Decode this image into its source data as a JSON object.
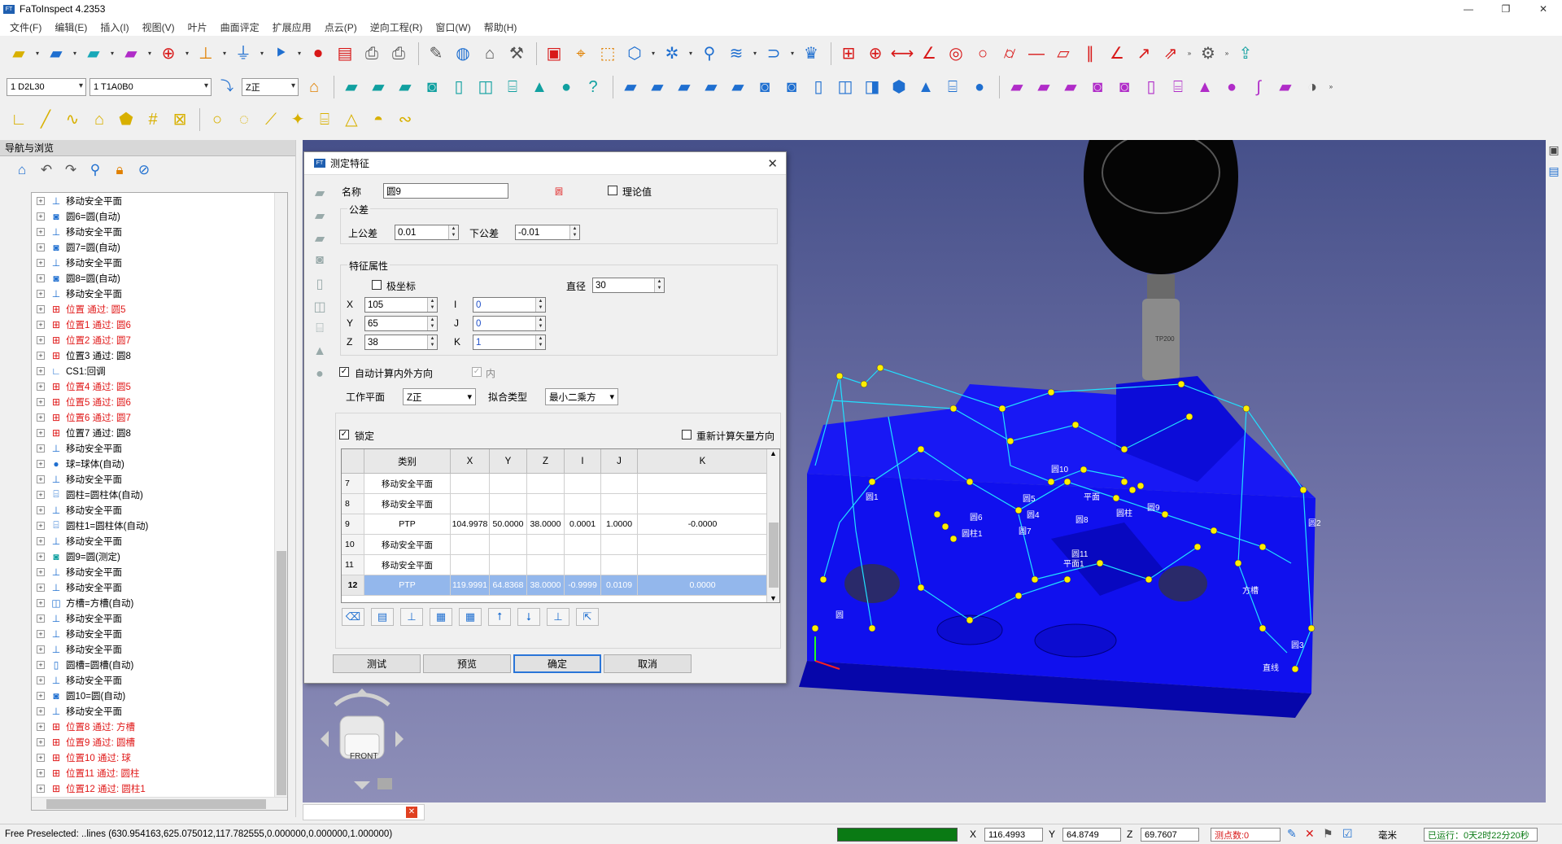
{
  "app": {
    "title": "FaToInspect 4.2353"
  },
  "menu": [
    "文件(F)",
    "编辑(E)",
    "插入(I)",
    "视图(V)",
    "叶片",
    "曲面评定",
    "扩展应用",
    "点云(P)",
    "逆向工程(R)",
    "窗口(W)",
    "帮助(H)"
  ],
  "toolbar2": {
    "probe": "1 D2L30",
    "tip": "1 T1A0B0",
    "workplane": "Z正"
  },
  "nav": {
    "title": "导航与浏览",
    "items": [
      {
        "label": "移动安全平面",
        "icon": "move-plane-icon",
        "red": false
      },
      {
        "label": "圆6=圆(自动)",
        "icon": "circle-feature-icon",
        "red": false
      },
      {
        "label": "移动安全平面",
        "icon": "move-plane-icon",
        "red": false
      },
      {
        "label": "圆7=圆(自动)",
        "icon": "circle-feature-icon",
        "red": false
      },
      {
        "label": "移动安全平面",
        "icon": "move-plane-icon",
        "red": false
      },
      {
        "label": "圆8=圆(自动)",
        "icon": "circle-feature-icon",
        "red": false
      },
      {
        "label": "移动安全平面",
        "icon": "move-plane-icon",
        "red": false
      },
      {
        "label": "位置 通过: 圆5",
        "icon": "position-icon",
        "red": true
      },
      {
        "label": "位置1 通过: 圆6",
        "icon": "position-icon",
        "red": true
      },
      {
        "label": "位置2 通过: 圆7",
        "icon": "position-icon",
        "red": true
      },
      {
        "label": "位置3 通过: 圆8",
        "icon": "position-icon",
        "red": false
      },
      {
        "label": "CS1:回调",
        "icon": "coordinate-system-icon",
        "red": false
      },
      {
        "label": "位置4 通过: 圆5",
        "icon": "position-icon",
        "red": true
      },
      {
        "label": "位置5 通过: 圆6",
        "icon": "position-icon",
        "red": true
      },
      {
        "label": "位置6 通过: 圆7",
        "icon": "position-icon",
        "red": true
      },
      {
        "label": "位置7 通过: 圆8",
        "icon": "position-icon",
        "red": false
      },
      {
        "label": "移动安全平面",
        "icon": "move-plane-icon",
        "red": false
      },
      {
        "label": "球=球体(自动)",
        "icon": "sphere-icon",
        "red": false
      },
      {
        "label": "移动安全平面",
        "icon": "move-plane-icon",
        "red": false
      },
      {
        "label": "圆柱=圆柱体(自动)",
        "icon": "cylinder-icon",
        "red": false
      },
      {
        "label": "移动安全平面",
        "icon": "move-plane-icon",
        "red": false
      },
      {
        "label": "圆柱1=圆柱体(自动)",
        "icon": "cylinder-icon",
        "red": false
      },
      {
        "label": "移动安全平面",
        "icon": "move-plane-icon",
        "red": false
      },
      {
        "label": "圆9=圆(测定)",
        "icon": "circle-measured-icon",
        "red": false
      },
      {
        "label": "移动安全平面",
        "icon": "move-plane-icon",
        "red": false
      },
      {
        "label": "移动安全平面",
        "icon": "move-plane-icon",
        "red": false
      },
      {
        "label": "方槽=方槽(自动)",
        "icon": "square-slot-icon",
        "red": false
      },
      {
        "label": "移动安全平面",
        "icon": "move-plane-icon",
        "red": false
      },
      {
        "label": "移动安全平面",
        "icon": "move-plane-icon",
        "red": false
      },
      {
        "label": "移动安全平面",
        "icon": "move-plane-icon",
        "red": false
      },
      {
        "label": "圆槽=圆槽(自动)",
        "icon": "round-slot-icon",
        "red": false
      },
      {
        "label": "移动安全平面",
        "icon": "move-plane-icon",
        "red": false
      },
      {
        "label": "圆10=圆(自动)",
        "icon": "circle-feature-icon",
        "red": false
      },
      {
        "label": "移动安全平面",
        "icon": "move-plane-icon",
        "red": false
      },
      {
        "label": "位置8 通过: 方槽",
        "icon": "position-icon",
        "red": true
      },
      {
        "label": "位置9 通过: 圆槽",
        "icon": "position-icon",
        "red": true
      },
      {
        "label": "位置10 通过: 球",
        "icon": "position-icon",
        "red": true
      },
      {
        "label": "位置11 通过: 圆柱",
        "icon": "position-icon",
        "red": true
      },
      {
        "label": "位置12 通过: 圆柱1",
        "icon": "position-icon",
        "red": true
      }
    ]
  },
  "dialog": {
    "title": "测定特征",
    "name_label": "名称",
    "name_value": "圆9",
    "type_mark": "圆",
    "theory_label": "理论值",
    "tolerance_group": "公差",
    "upper_label": "上公差",
    "upper_value": "0.01",
    "lower_label": "下公差",
    "lower_value": "-0.01",
    "props_group": "特征属性",
    "polar_label": "极坐标",
    "diameter_label": "直径",
    "diameter_value": "30",
    "x_label": "X",
    "x_value": "105",
    "y_label": "Y",
    "y_value": "65",
    "z_label": "Z",
    "z_value": "38",
    "i_label": "I",
    "i_value": "0",
    "j_label": "J",
    "j_value": "0",
    "k_label": "K",
    "k_value": "1",
    "auto_dir_label": "自动计算内外方向",
    "inner_label": "内",
    "workplane_label": "工作平面",
    "workplane_value": "Z正",
    "fit_label": "拟合类型",
    "fit_value": "最小二乘方",
    "lock_label": "锁定",
    "recalc_label": "重新计算矢量方向",
    "table": {
      "headers": [
        "",
        "类别",
        "X",
        "Y",
        "Z",
        "I",
        "J",
        "K"
      ],
      "rows": [
        {
          "n": "7",
          "type": "移动安全平面",
          "x": "",
          "y": "",
          "z": "",
          "i": "",
          "j": "",
          "k": ""
        },
        {
          "n": "8",
          "type": "移动安全平面",
          "x": "",
          "y": "",
          "z": "",
          "i": "",
          "j": "",
          "k": ""
        },
        {
          "n": "9",
          "type": "PTP",
          "x": "104.9978",
          "y": "50.0000",
          "z": "38.0000",
          "i": "0.0001",
          "j": "1.0000",
          "k": "-0.0000"
        },
        {
          "n": "10",
          "type": "移动安全平面",
          "x": "",
          "y": "",
          "z": "",
          "i": "",
          "j": "",
          "k": ""
        },
        {
          "n": "11",
          "type": "移动安全平面",
          "x": "",
          "y": "",
          "z": "",
          "i": "",
          "j": "",
          "k": ""
        },
        {
          "n": "12",
          "type": "PTP",
          "x": "119.9991",
          "y": "64.8368",
          "z": "38.0000",
          "i": "-0.9999",
          "j": "0.0109",
          "k": "0.0000"
        }
      ]
    },
    "buttons": {
      "test": "测试",
      "preview": "预览",
      "ok": "确定",
      "cancel": "取消"
    }
  },
  "viewport": {
    "probe_label": "TP200",
    "cube_label": "FRONT",
    "feature_labels": [
      "圆10",
      "圆5",
      "圆4",
      "圆8",
      "平面",
      "圆柱",
      "圆9",
      "圆6",
      "圆7",
      "圆11",
      "平面1",
      "方槽",
      "圆3",
      "圆2",
      "圆1",
      "圆柱1",
      "直线",
      "圆"
    ]
  },
  "status": {
    "preselect": "Free Preselected: ..lines (630.954163,625.075012,117.782555,0.000000,0.000000,1.000000)",
    "x_label": "X",
    "x_value": "116.4993",
    "y_label": "Y",
    "y_value": "64.8749",
    "z_label": "Z",
    "z_value": "69.7607",
    "points": "测点数:0",
    "unit": "毫米",
    "runtime": "已运行：0天2时22分20秒"
  },
  "colors": {
    "part": "#1010ee",
    "nav_red": "#e01818",
    "progress": "#0a7a14",
    "accent": "#2a75d8"
  }
}
